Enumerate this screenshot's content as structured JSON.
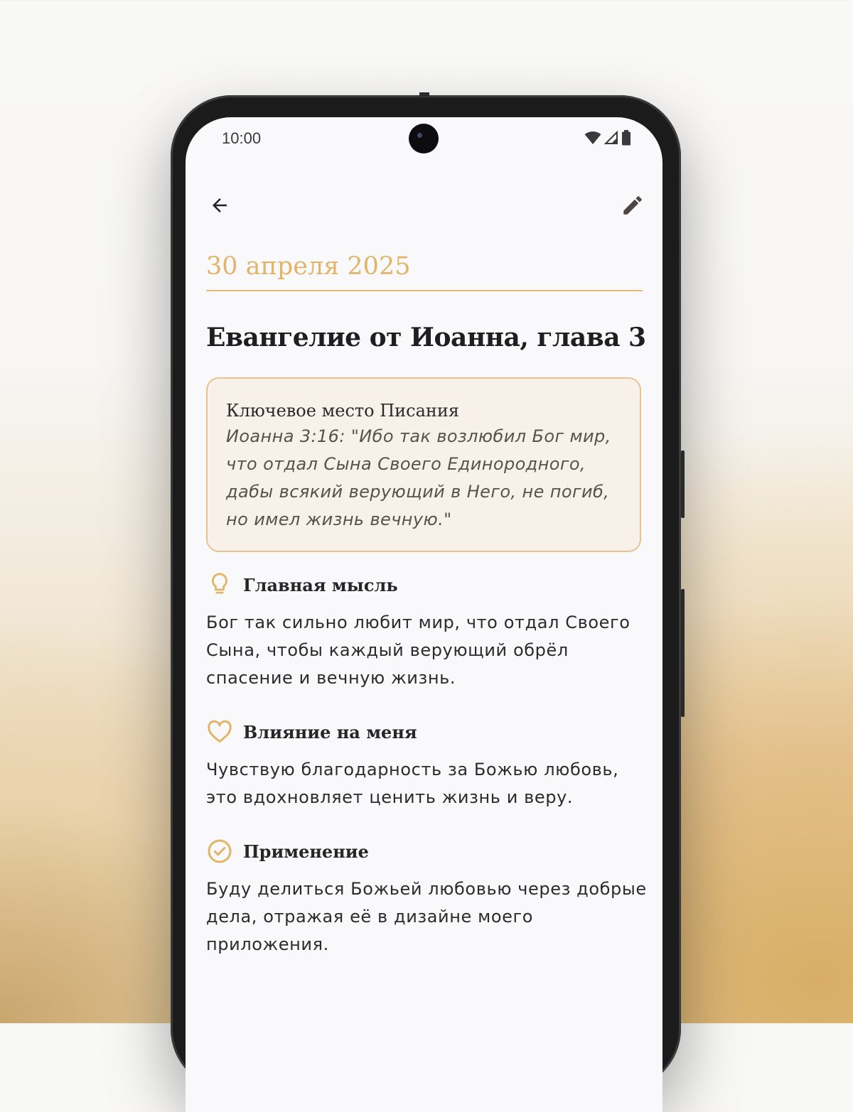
{
  "status_bar": {
    "time": "10:00"
  },
  "entry": {
    "date": "30 апреля 2025",
    "title": "Евангелие от Иоанна, глава 3"
  },
  "key_passage": {
    "label": "Ключевое место Писания",
    "text": "Иоанна 3:16: \"Ибо так возлюбил Бог мир, что отдал Сына Своего Единородного, дабы всякий верующий в Него, не погиб, но имел жизнь вечную.\""
  },
  "sections": [
    {
      "icon": "lightbulb-icon",
      "title": "Главная мысль",
      "body": "Бог так сильно любит мир, что отдал Своего Сына, чтобы каждый верующий обрёл спасение и вечную жизнь."
    },
    {
      "icon": "heart-icon",
      "title": "Влияние на меня",
      "body": "Чувствую благодарность за Божью любовь, это вдохновляет ценить жизнь и веру."
    },
    {
      "icon": "check-circle-icon",
      "title": "Применение",
      "body": "Буду делиться Божьей любовью через добрые дела, отражая её в дизайне моего приложения."
    }
  ],
  "colors": {
    "accent": "#e1b468",
    "card_bg": "#f8f1ea",
    "card_border": "#e6c391"
  }
}
